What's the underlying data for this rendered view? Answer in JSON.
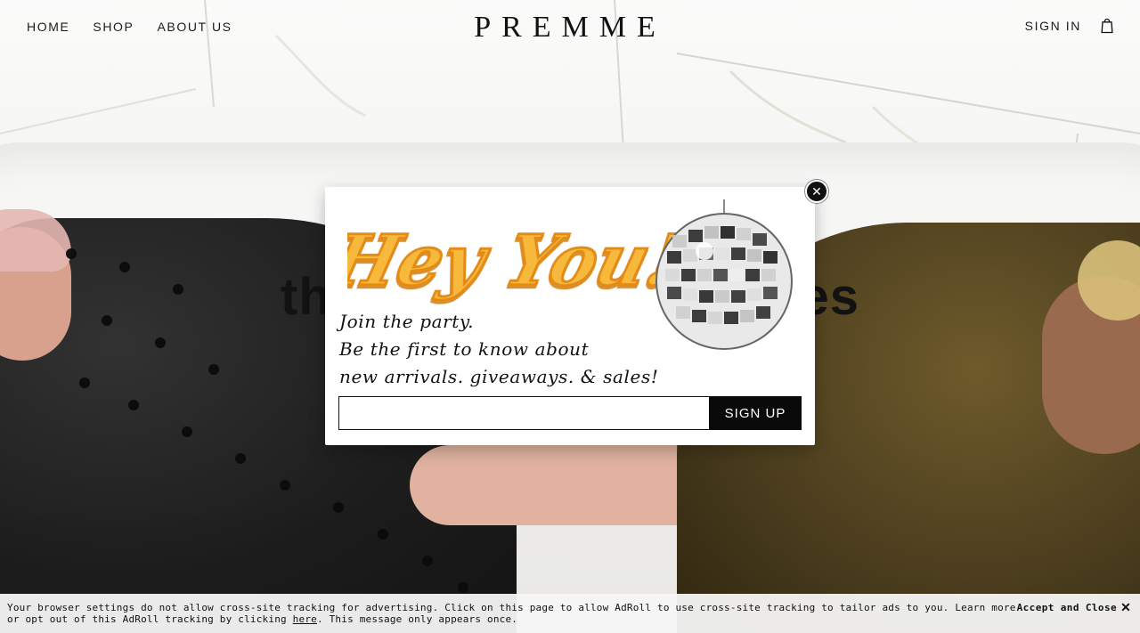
{
  "header": {
    "nav": [
      {
        "label": "HOME"
      },
      {
        "label": "SHOP"
      },
      {
        "label": "ABOUT US"
      }
    ],
    "logo": "PREMME",
    "sign_in": "SIGN IN",
    "cart_icon": "shopping-bag-icon"
  },
  "hero": {
    "headline_left": "th",
    "headline_right": "es"
  },
  "popup": {
    "headline": "Hey You!",
    "lines": [
      "Join the party.",
      "Be the first to know about",
      "new arrivals. giveaways. & sales!"
    ],
    "email_value": "",
    "email_placeholder": "",
    "signup_label": "SIGN UP",
    "close_icon": "close-icon",
    "decor_icon": "disco-ball-icon"
  },
  "consent": {
    "text_before_link": "Your browser settings do not allow cross-site tracking for advertising. Click on this page to allow AdRoll to use cross-site tracking to tailor ads to you. Learn more or opt out of this AdRoll tracking by clicking ",
    "link_text": "here",
    "text_after_link": ". This message only appears once.",
    "accept_label": "Accept and Close",
    "close_symbol": "✕"
  },
  "colors": {
    "popup_headline_fill": "#f6b93b",
    "popup_headline_stroke": "#e38b15",
    "signup_button": "#0a0a0a"
  }
}
